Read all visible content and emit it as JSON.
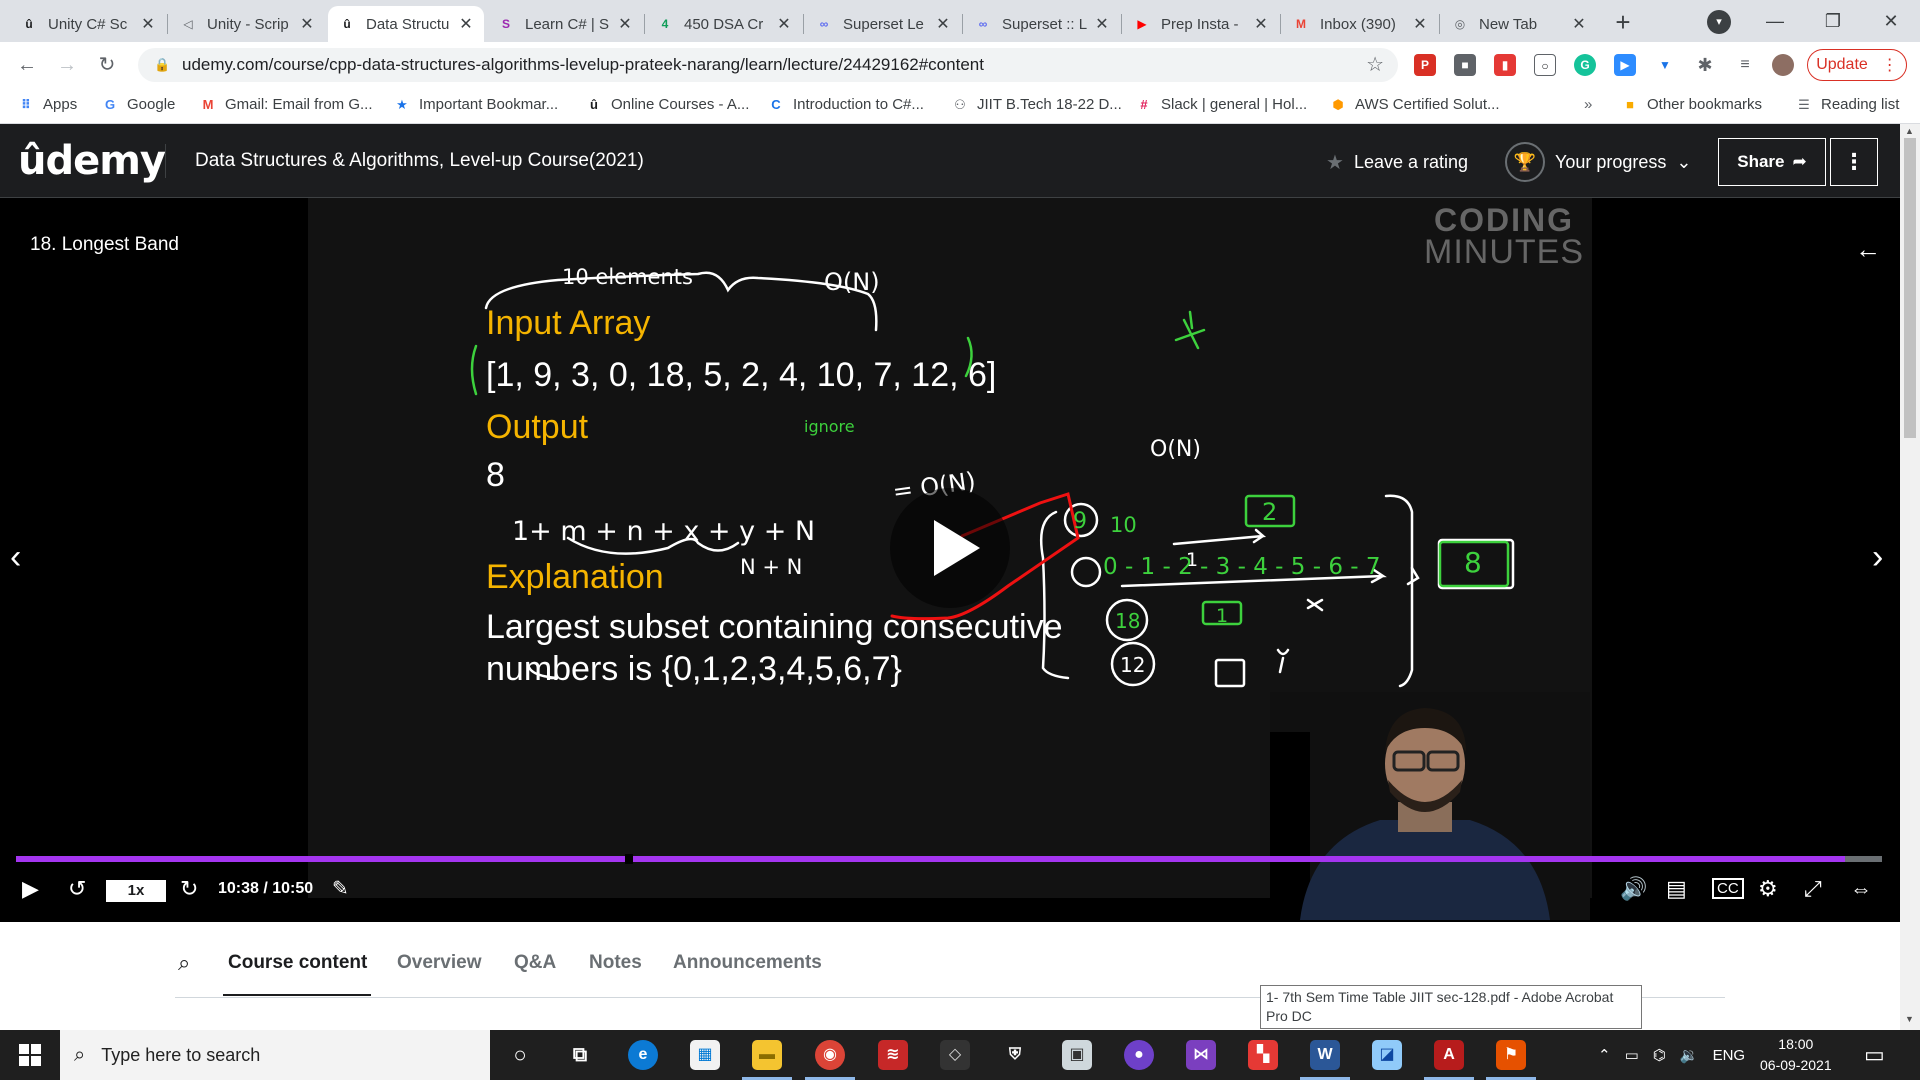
{
  "browser": {
    "tabs": [
      {
        "title": "Unity C# Sc",
        "icon": "udemy-icon",
        "color": "#1c1d1f",
        "active": false
      },
      {
        "title": "Unity - Scrip",
        "icon": "unity-icon",
        "color": "#5f6368",
        "active": false
      },
      {
        "title": "Data Structu",
        "icon": "udemy-icon",
        "color": "#1c1d1f",
        "active": true
      },
      {
        "title": "Learn C# | S",
        "icon": "sololearn-icon",
        "color": "#9c27b0",
        "active": false
      },
      {
        "title": "450 DSA Cr",
        "icon": "sheets-icon",
        "color": "#0f9d58",
        "active": false
      },
      {
        "title": "Superset Le",
        "icon": "superset-icon",
        "color": "#5b6af0",
        "active": false
      },
      {
        "title": "Superset :: L",
        "icon": "superset-icon",
        "color": "#5b6af0",
        "active": false
      },
      {
        "title": "Prep Insta -",
        "icon": "youtube-icon",
        "color": "#ff0000",
        "active": false
      },
      {
        "title": "Inbox (390)",
        "icon": "gmail-icon",
        "color": "#ea4335",
        "active": false
      },
      {
        "title": "New Tab",
        "icon": "chrome-icon",
        "color": "#5f6368",
        "active": false
      }
    ],
    "url": "udemy.com/course/cpp-data-structures-algorithms-levelup-prateek-narang/learn/lecture/24429162#content",
    "update_label": "Update",
    "bookmarks": [
      {
        "label": "Apps",
        "icon": "apps-grid-icon"
      },
      {
        "label": "Google",
        "icon": "google-icon"
      },
      {
        "label": "Gmail: Email from G...",
        "icon": "gmail-icon"
      },
      {
        "label": "Important Bookmar...",
        "icon": "star-icon"
      },
      {
        "label": "Online Courses - A...",
        "icon": "udemy-icon"
      },
      {
        "label": "Introduction to C#...",
        "icon": "c-icon"
      },
      {
        "label": "JIIT B.Tech 18-22 D...",
        "icon": "group-icon"
      },
      {
        "label": "Slack | general | Hol...",
        "icon": "slack-icon"
      },
      {
        "label": "AWS Certified Solut...",
        "icon": "aws-icon"
      }
    ],
    "bookmarks_overflow": "»",
    "other_bookmarks": "Other bookmarks",
    "reading_list": "Reading list"
  },
  "udemy": {
    "logo": "ûdemy",
    "course_title": "Data Structures & Algorithms, Level-up Course(2021)",
    "leave_rating": "Leave a rating",
    "your_progress": "Your progress",
    "share": "Share"
  },
  "video": {
    "lecture_title": "18. Longest Band",
    "brand_line1": "CODING",
    "brand_line2": "MINUTES",
    "slide": {
      "input_heading": "Input Array",
      "input_values": "[1, 9, 3, 0, 18, 5, 2, 4, 10, 7, 12, 6]",
      "output_heading": "Output",
      "output_value": "8",
      "explanation_heading": "Explanation",
      "explanation_line1": "Largest subset containing consecutive",
      "explanation_line2": "numbers is {0,1,2,3,4,5,6,7}"
    },
    "annotations": {
      "elements_note": "10 elements",
      "complexity_top": "O(N)",
      "formula": "1+ m + n + x + y + N",
      "formula_result": "= O(N)",
      "formula_sub": "N + N",
      "ignore_note": "ignore",
      "complexity_right": "O(N)",
      "chain": "0 - 1 - 2 - 3 - 4 - 5 - 6 - 7",
      "n9": "9",
      "n10": "10",
      "n18": "18",
      "n12": "12",
      "count2": "2",
      "count8": "8",
      "count1a": "1",
      "count1b": "1"
    },
    "playback": {
      "speed": "1x",
      "time": "10:38 / 10:50",
      "progress_fraction": 0.98
    },
    "accent_color": "#a435f0"
  },
  "course_tabs": [
    "Course content",
    "Overview",
    "Q&A",
    "Notes",
    "Announcements"
  ],
  "tooltip": "1- 7th Sem Time Table JIIT sec-128.pdf - Adobe Acrobat Pro DC",
  "taskbar": {
    "search_placeholder": "Type here to search",
    "language": "ENG",
    "time": "18:00",
    "date": "06-09-2021"
  }
}
